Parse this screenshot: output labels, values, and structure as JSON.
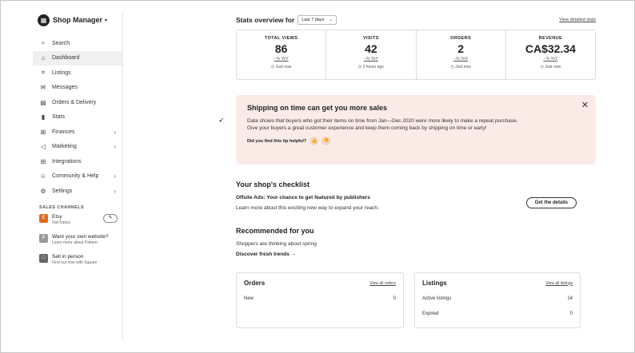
{
  "sidebar": {
    "brand": "Shop Manager",
    "items": [
      {
        "label": "Search",
        "icon": "search-icon",
        "glyph": "⌕",
        "chev": false
      },
      {
        "label": "Dashboard",
        "icon": "home-icon",
        "glyph": "⌂",
        "chev": false,
        "active": true
      },
      {
        "label": "Listings",
        "icon": "tag-icon",
        "glyph": "⌗",
        "chev": false
      },
      {
        "label": "Messages",
        "icon": "mail-icon",
        "glyph": "✉",
        "chev": false
      },
      {
        "label": "Orders & Delivery",
        "icon": "clipboard-icon",
        "glyph": "▤",
        "chev": false
      },
      {
        "label": "Stats",
        "icon": "bar-chart-icon",
        "glyph": "▮",
        "chev": false
      },
      {
        "label": "Finances",
        "icon": "bank-icon",
        "glyph": "⊞",
        "chev": true
      },
      {
        "label": "Marketing",
        "icon": "megaphone-icon",
        "glyph": "◁",
        "chev": true
      },
      {
        "label": "Integrations",
        "icon": "grid-icon",
        "glyph": "⊞",
        "chev": false
      },
      {
        "label": "Community & Help",
        "icon": "people-icon",
        "glyph": "☺",
        "chev": true
      },
      {
        "label": "Settings",
        "icon": "gear-icon",
        "glyph": "⚙",
        "chev": true
      }
    ],
    "sales_channels": {
      "heading": "SALES CHANNELS",
      "etsy": {
        "title": "Etsy",
        "sub": "VanTopics",
        "icon_letter": "E",
        "color": "#e46b24"
      },
      "pattern": {
        "title": "Want your own website?",
        "sub": "Learn more about Pattern",
        "icon_letter": "P",
        "color": "#999999"
      },
      "square": {
        "title": "Sell in person",
        "sub": "Find out how with Square",
        "icon_letter": "□",
        "color": "#666666"
      }
    }
  },
  "stats": {
    "title": "Stats overview for",
    "period": "Last 7 days",
    "view_link": "View detailed stats",
    "items": [
      {
        "label": "TOTAL VIEWS",
        "value": "86",
        "yoy": "--% YoY",
        "time": "Just now"
      },
      {
        "label": "VISITS",
        "value": "42",
        "yoy": "--% YoY",
        "time": "3 hours ago"
      },
      {
        "label": "ORDERS",
        "value": "2",
        "yoy": "--% YoY",
        "time": "Just now"
      },
      {
        "label": "REVENUE",
        "value": "CA$32.34",
        "yoy": "--% YoY",
        "time": "Just now"
      }
    ]
  },
  "tip": {
    "title": "Shipping on time can get you more sales",
    "body": "Data shows that buyers who got their items on time from Jan—Dec 2020 were more likely to make a repeat purchase. Give your buyers a great customer experience and keep them coming back by shipping on time or early!",
    "helpful": "Did you find this tip helpful?"
  },
  "checklist": {
    "title": "Your shop's checklist",
    "heading": "Offsite Ads: Your chance to get featured by publishers",
    "text": "Learn more about this exciting new way to expand your reach.",
    "button": "Get the details"
  },
  "recommended": {
    "title": "Recommended for you",
    "text": "Shoppers are thinking about spring",
    "link": "Discover fresh trends →"
  },
  "orders_card": {
    "title": "Orders",
    "link": "View all orders",
    "rows": [
      {
        "label": "New",
        "value": "0"
      }
    ]
  },
  "listings_card": {
    "title": "Listings",
    "link": "View all listings",
    "rows": [
      {
        "label": "Active listings",
        "value": "14"
      },
      {
        "label": "Expired",
        "value": "0"
      }
    ]
  }
}
